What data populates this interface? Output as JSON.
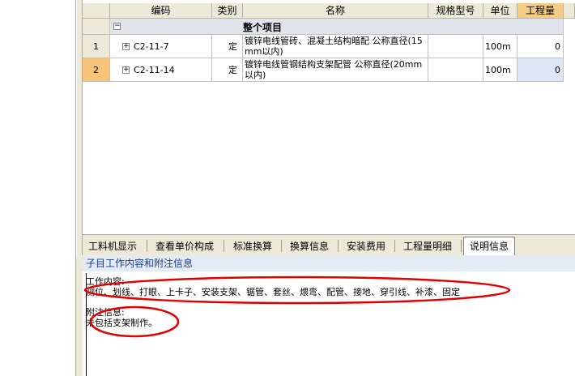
{
  "grid": {
    "columns": [
      "编码",
      "类别",
      "名称",
      "规格型号",
      "单位",
      "工程量"
    ],
    "group_row": {
      "expander": "−",
      "title": "整个项目"
    },
    "rows": [
      {
        "num": "1",
        "code": "C2-11-7",
        "type": "定",
        "name": "镀锌电线管砖、混凝土结构暗配 公称直径(15mm以内)",
        "spec": "",
        "unit": "100m",
        "qty": "0"
      },
      {
        "num": "2",
        "code": "C2-11-14",
        "type": "定",
        "name": "镀锌电线管钢结构支架配管 公称直径(20mm以内)",
        "spec": "",
        "unit": "100m",
        "qty": "0"
      }
    ]
  },
  "tabs": [
    "工料机显示",
    "查看单价构成",
    "标准换算",
    "换算信息",
    "安装费用",
    "工程量明细",
    "说明信息"
  ],
  "info": {
    "title": "子目工作内容和附注信息",
    "work_label": "工作内容:",
    "work_content": "测位、划线、打眼、上卡子、安装支架、锯管、套丝、煨弯、配管、接地、穿引线、补漆、固定",
    "note_label": "附注信息:",
    "note_content": "未包括支架制作。"
  },
  "colors": {
    "highlight": "#f5cc84",
    "annotation": "#e00000",
    "title_text": "#1a3c8c"
  }
}
